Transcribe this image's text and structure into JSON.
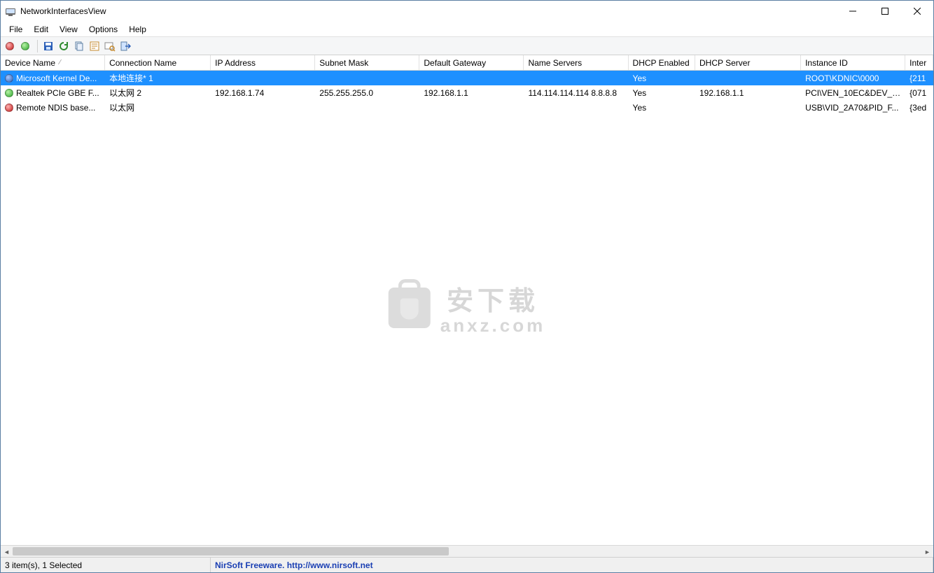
{
  "window": {
    "title": "NetworkInterfacesView"
  },
  "menu": {
    "items": [
      "File",
      "Edit",
      "View",
      "Options",
      "Help"
    ]
  },
  "toolbar": {
    "icons": [
      "disable-icon",
      "enable-icon",
      "save-icon",
      "refresh-icon",
      "copy-icon",
      "properties-icon",
      "find-icon",
      "exit-icon"
    ]
  },
  "columns": [
    {
      "label": "Device Name",
      "sorted": true
    },
    {
      "label": "Connection Name"
    },
    {
      "label": "IP Address"
    },
    {
      "label": "Subnet Mask"
    },
    {
      "label": "Default Gateway"
    },
    {
      "label": "Name Servers"
    },
    {
      "label": "DHCP Enabled"
    },
    {
      "label": "DHCP Server"
    },
    {
      "label": "Instance ID"
    },
    {
      "label": "Inter"
    }
  ],
  "rows": [
    {
      "status": "blue",
      "selected": true,
      "cells": [
        "Microsoft Kernel De...",
        "本地连接* 1",
        "",
        "",
        "",
        "",
        "Yes",
        "",
        "ROOT\\KDNIC\\0000",
        "{211"
      ]
    },
    {
      "status": "green",
      "selected": false,
      "cells": [
        "Realtek PCIe GBE F...",
        "以太网 2",
        "192.168.1.74",
        "255.255.255.0",
        "192.168.1.1",
        "114.114.114.114 8.8.8.8",
        "Yes",
        "192.168.1.1",
        "PCI\\VEN_10EC&DEV_8...",
        "{071"
      ]
    },
    {
      "status": "red",
      "selected": false,
      "cells": [
        "Remote NDIS base...",
        "以太网",
        "",
        "",
        "",
        "",
        "Yes",
        "",
        "USB\\VID_2A70&PID_F...",
        "{3ed"
      ]
    }
  ],
  "status": {
    "left": "3 item(s), 1 Selected",
    "brand": "NirSoft Freeware.  ",
    "url": "http://www.nirsoft.net"
  },
  "watermark": {
    "cn": "安下载",
    "en": "anxz.com"
  }
}
